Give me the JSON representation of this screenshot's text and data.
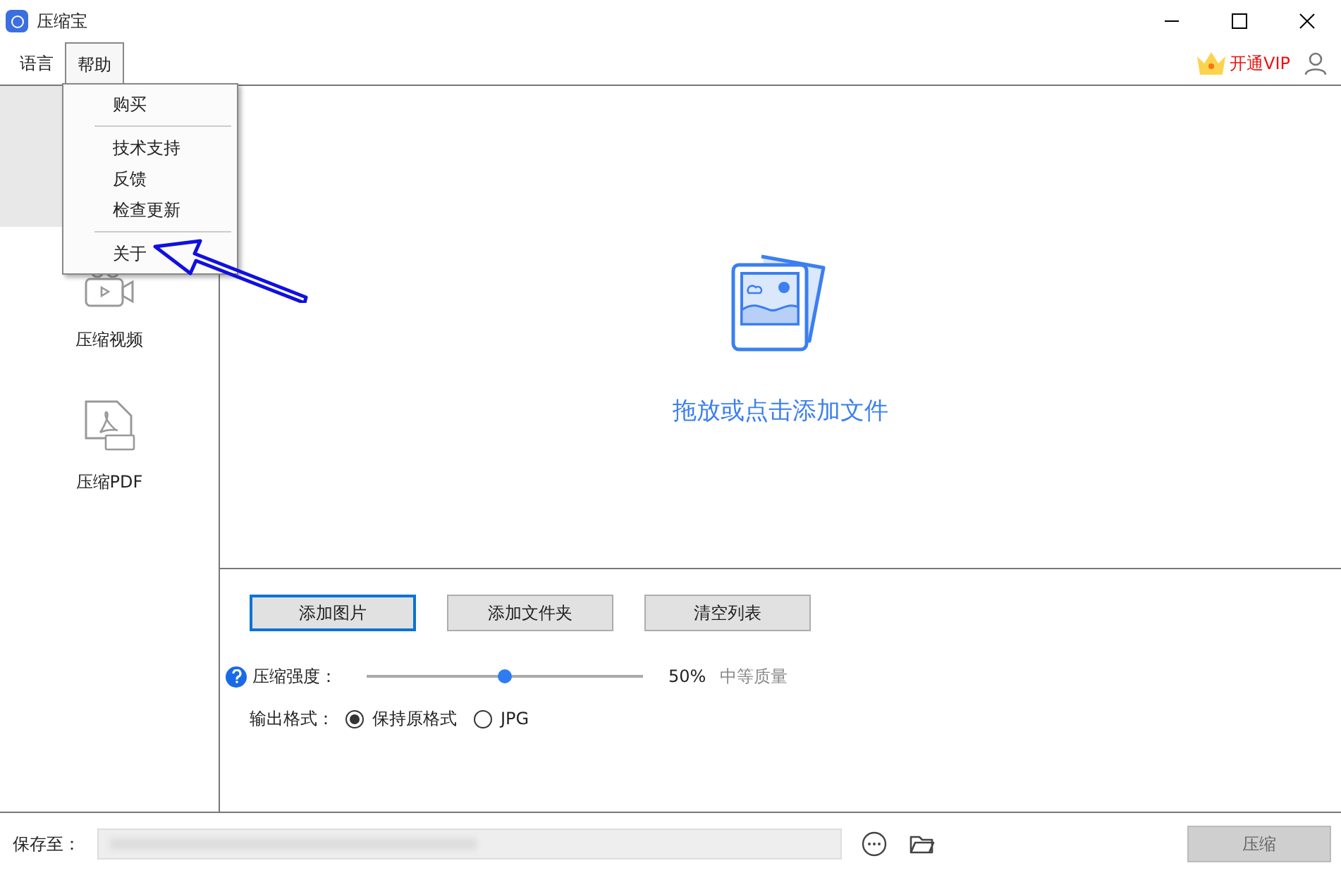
{
  "window": {
    "title": "压缩宝"
  },
  "menu_bar": [
    {
      "label": "语言",
      "selected": false
    },
    {
      "label": "帮助",
      "selected": true
    }
  ],
  "help_menu": {
    "items": [
      {
        "kind": "item",
        "label": "购买"
      },
      {
        "kind": "separator"
      },
      {
        "kind": "item",
        "label": "技术支持"
      },
      {
        "kind": "item",
        "label": "反馈"
      },
      {
        "kind": "item",
        "label": "检查更新"
      },
      {
        "kind": "separator"
      },
      {
        "kind": "item",
        "label": "关于"
      }
    ]
  },
  "vip": {
    "label": "开通VIP"
  },
  "sidebar": {
    "items": [
      {
        "kind": "hidden",
        "selected": true
      },
      {
        "kind": "video",
        "label": "压缩视频",
        "selected": false
      },
      {
        "kind": "pdf",
        "label": "压缩PDF",
        "selected": false
      }
    ]
  },
  "drop_zone": {
    "text": "拖放或点击添加文件"
  },
  "buttons": [
    {
      "label": "添加图片",
      "focused": true
    },
    {
      "label": "添加文件夹",
      "focused": false
    },
    {
      "label": "清空列表",
      "focused": false
    }
  ],
  "compression": {
    "label": "压缩强度：",
    "level": 0.5,
    "reading": "50%",
    "quality": "中等质量"
  },
  "output_format": {
    "label": "输出格式：",
    "options": [
      {
        "label": "保持原格式",
        "selected": true
      },
      {
        "label": "JPG",
        "selected": false
      }
    ]
  },
  "footer": {
    "label": "保存至：",
    "compress_button": "压缩"
  }
}
